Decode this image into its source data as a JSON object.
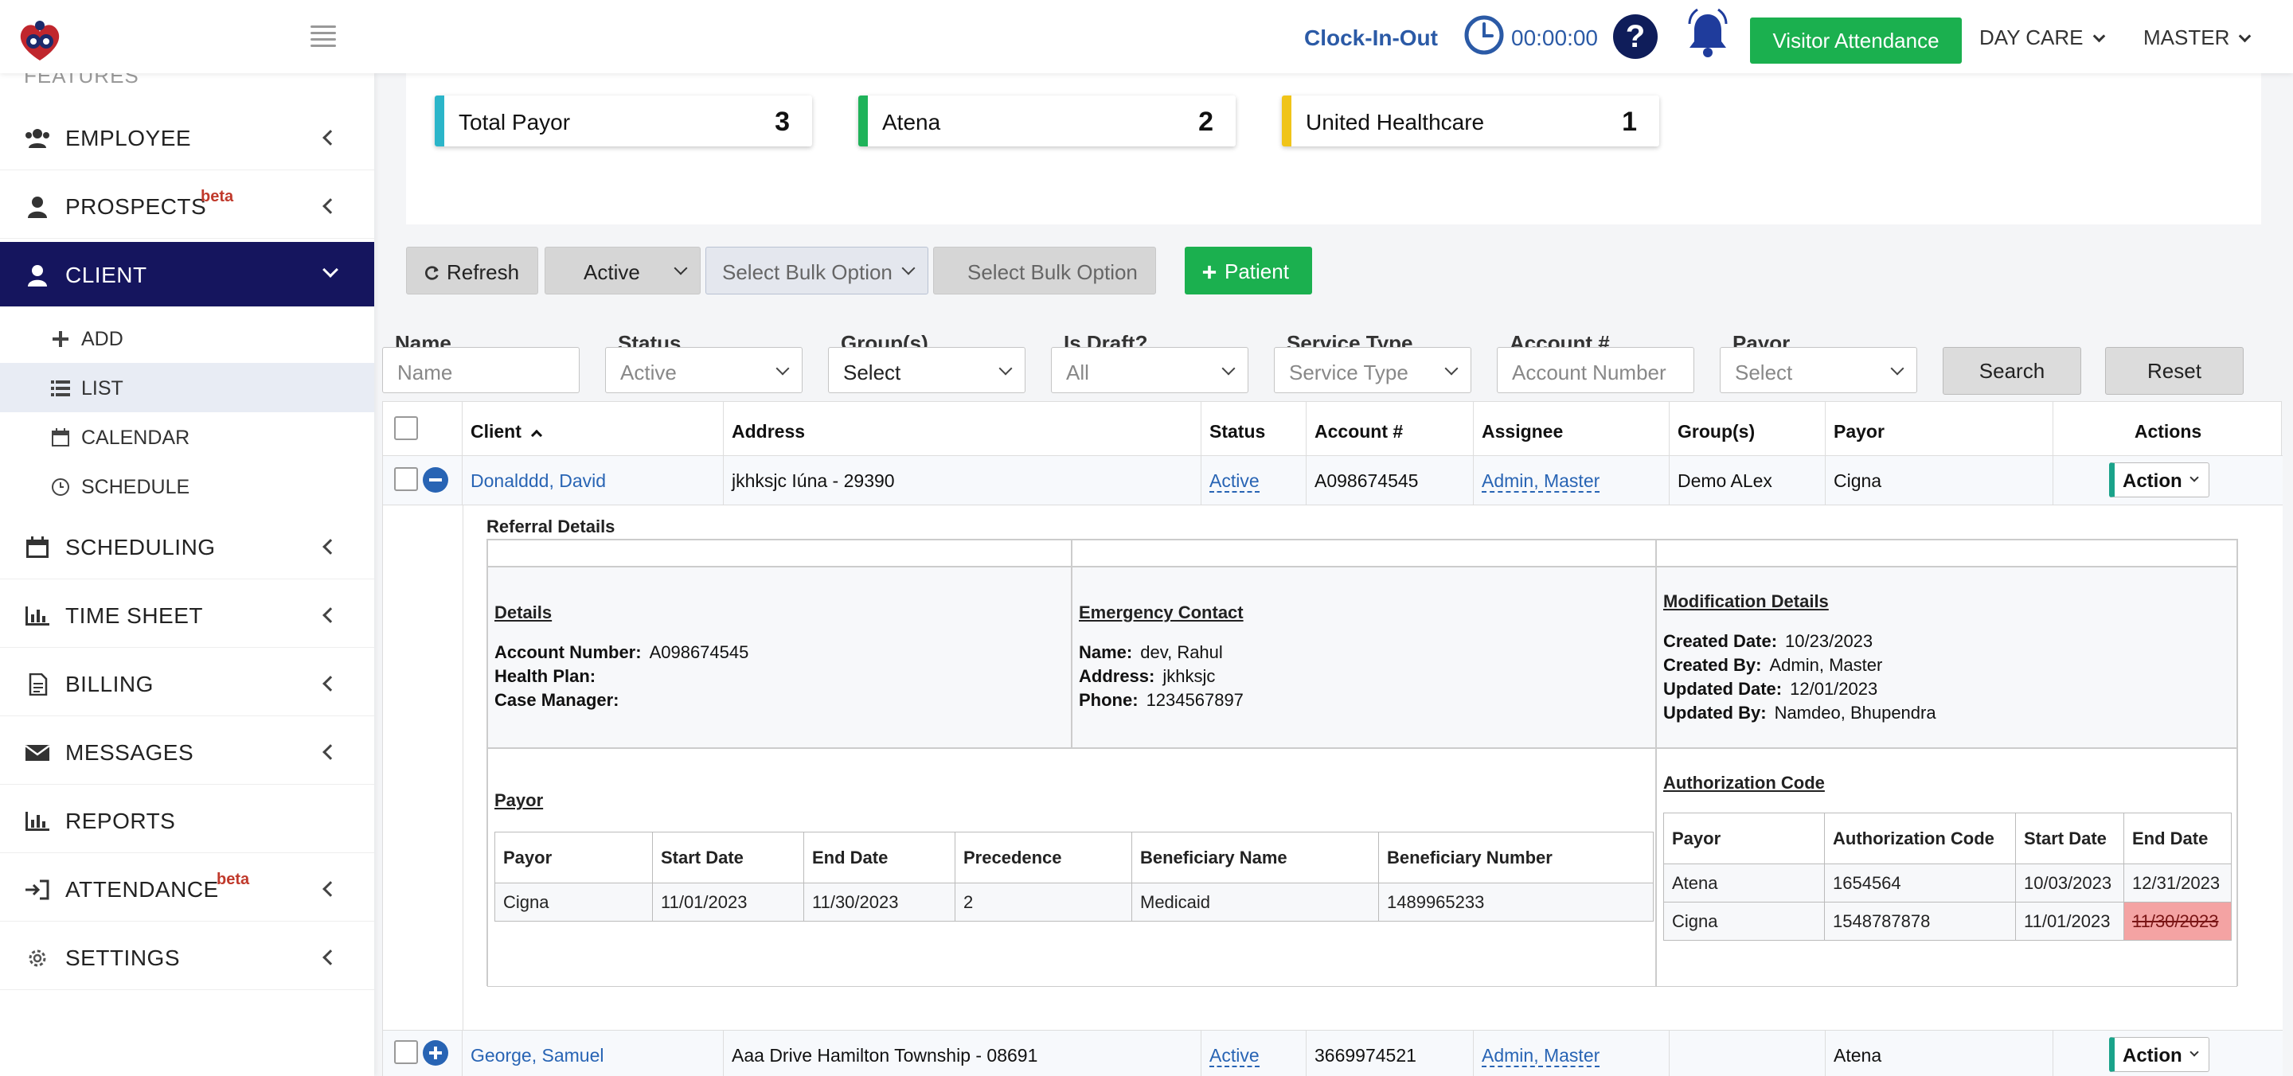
{
  "header": {
    "clock_label": "Clock-In-Out",
    "clock_time": "00:00:00",
    "visitor_button": "Visitor Attendance",
    "menus": [
      "DAY CARE",
      "MASTER"
    ]
  },
  "sidebar": {
    "features_label": "FEATURES",
    "items": [
      {
        "label": "EMPLOYEE",
        "icon": "users-icon"
      },
      {
        "label": "PROSPECTS",
        "icon": "user-icon",
        "badge": "beta"
      },
      {
        "label": "CLIENT",
        "icon": "user-icon"
      },
      {
        "label": "SCHEDULING",
        "icon": "calendar-icon"
      },
      {
        "label": "TIME SHEET",
        "icon": "bar-chart-icon"
      },
      {
        "label": "BILLING",
        "icon": "document-icon"
      },
      {
        "label": "MESSAGES",
        "icon": "envelope-icon"
      },
      {
        "label": "REPORTS",
        "icon": "bar-chart-icon"
      },
      {
        "label": "ATTENDANCE",
        "icon": "sign-in-icon",
        "badge": "beta"
      },
      {
        "label": "SETTINGS",
        "icon": "gear-icon"
      }
    ],
    "client_sub": [
      {
        "label": "ADD",
        "icon": "plus-icon"
      },
      {
        "label": "LIST",
        "icon": "list-icon"
      },
      {
        "label": "CALENDAR",
        "icon": "calendar-icon"
      },
      {
        "label": "SCHEDULE",
        "icon": "clock-icon"
      }
    ]
  },
  "payor_cards": [
    {
      "name": "Total Payor",
      "count": "3",
      "color": "#2bb5c9"
    },
    {
      "name": "Atena",
      "count": "2",
      "color": "#1fb35a"
    },
    {
      "name": "United Healthcare",
      "count": "1",
      "color": "#f0c419"
    }
  ],
  "toolbar": {
    "refresh": "Refresh",
    "status_select": "Active",
    "bulk_select": "Select Bulk Option",
    "bulk_button": "Select Bulk Option",
    "patient_button": "Patient"
  },
  "filters": {
    "name_label": "Name",
    "name_placeholder": "Name",
    "status_label": "Status",
    "status_value": "Active",
    "groups_label": "Group(s)",
    "groups_value": "Select",
    "draft_label": "Is Draft?",
    "draft_value": "All",
    "service_label": "Service Type",
    "service_placeholder": "Service Type",
    "account_label": "Account #",
    "account_placeholder": "Account Number",
    "payor_label": "Payor",
    "payor_value": "Select",
    "search": "Search",
    "reset": "Reset"
  },
  "table": {
    "headers": [
      "Client",
      "Address",
      "Status",
      "Account #",
      "Assignee",
      "Group(s)",
      "Payor",
      "Actions"
    ],
    "rows": [
      {
        "client": "Donalddd, David",
        "address": "jkhksjc Iúna - 29390",
        "status": "Active",
        "account": "A098674545",
        "assignee": "Admin, Master",
        "group": "Demo ALex",
        "payor": "Cigna",
        "action": "Action"
      },
      {
        "client": "George, Samuel",
        "address": "Aaa Drive Hamilton Township - 08691",
        "status": "Active",
        "account": "3669974521",
        "assignee": "Admin, Master",
        "group": "",
        "payor": "Atena",
        "action": "Action"
      }
    ]
  },
  "referral": {
    "title": "Referral Details",
    "details": {
      "title": "Details",
      "account_label": "Account Number:",
      "account": "A098674545",
      "health_plan_label": "Health Plan:",
      "case_manager_label": "Case Manager:"
    },
    "emergency": {
      "title": "Emergency Contact",
      "name_label": "Name:",
      "name": "dev, Rahul",
      "address_label": "Address:",
      "address": "jkhksjc",
      "phone_label": "Phone:",
      "phone": "1234567897"
    },
    "modification": {
      "title": "Modification Details",
      "created_date_label": "Created Date:",
      "created_date": "10/23/2023",
      "created_by_label": "Created By:",
      "created_by": "Admin, Master",
      "updated_date_label": "Updated Date:",
      "updated_date": "12/01/2023",
      "updated_by_label": "Updated By:",
      "updated_by": "Namdeo, Bhupendra"
    },
    "payor": {
      "title": "Payor",
      "headers": [
        "Payor",
        "Start Date",
        "End Date",
        "Precedence",
        "Beneficiary Name",
        "Beneficiary Number"
      ],
      "rows": [
        [
          "Cigna",
          "11/01/2023",
          "11/30/2023",
          "2",
          "Medicaid",
          "1489965233"
        ]
      ]
    },
    "authorization": {
      "title": "Authorization Code",
      "headers": [
        "Payor",
        "Authorization Code",
        "Start Date",
        "End Date"
      ],
      "rows": [
        [
          "Atena",
          "1654564",
          "10/03/2023",
          "12/31/2023"
        ],
        [
          "Cigna",
          "1548787878",
          "11/01/2023",
          "11/30/2023"
        ]
      ]
    }
  }
}
